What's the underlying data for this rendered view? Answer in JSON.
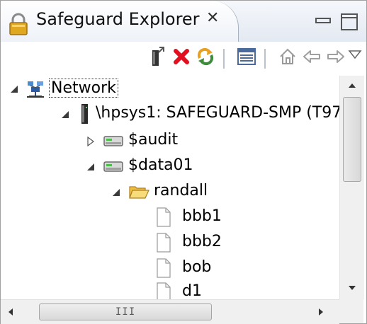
{
  "view": {
    "title": "Safeguard Explorer",
    "close_glyph": "✕"
  },
  "toolbar": {
    "buttons": [
      {
        "name": "new-connection-icon"
      },
      {
        "name": "disconnect-icon"
      },
      {
        "name": "refresh-icon"
      },
      {
        "name": "table-view-icon"
      },
      {
        "name": "home-icon"
      },
      {
        "name": "back-icon"
      },
      {
        "name": "forward-icon"
      },
      {
        "name": "view-menu-icon"
      }
    ]
  },
  "tree": {
    "network": "Network",
    "system": "\\hpsys1:  SAFEGUARD-SMP (T97",
    "volume_audit": "$audit",
    "volume_data": "$data01",
    "folder": "randall",
    "files": [
      "bbb1",
      "bbb2",
      "bob",
      "d1"
    ]
  },
  "scrollbar": {
    "grip": "III"
  },
  "colors": {
    "disconnect": "#e01020",
    "refresh": "#e8a020",
    "folder": "#f0c040"
  }
}
